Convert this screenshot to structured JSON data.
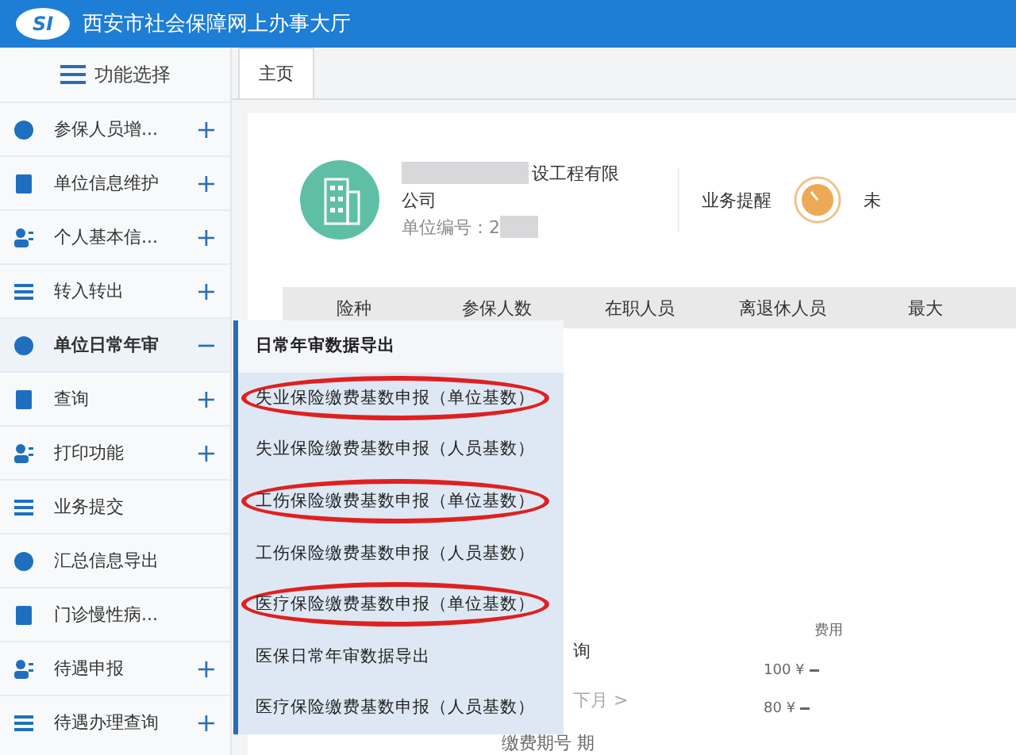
{
  "header": {
    "logo": "SI",
    "title": "西安市社会保障网上办事大厅"
  },
  "sidebar": {
    "title": "功能选择",
    "items": [
      {
        "label": "参保人员增...",
        "toggle": "+",
        "expanded": false
      },
      {
        "label": "单位信息维护",
        "toggle": "+",
        "expanded": false
      },
      {
        "label": "个人基本信...",
        "toggle": "+",
        "expanded": false
      },
      {
        "label": "转入转出",
        "toggle": "+",
        "expanded": false
      },
      {
        "label": "单位日常年审",
        "toggle": "−",
        "expanded": true
      },
      {
        "label": "查询",
        "toggle": "+",
        "expanded": false
      },
      {
        "label": "打印功能",
        "toggle": "+",
        "expanded": false
      },
      {
        "label": "业务提交",
        "expanded": false
      },
      {
        "label": "汇总信息导出",
        "expanded": false
      },
      {
        "label": "门诊慢性病...",
        "expanded": false
      },
      {
        "label": "待遇申报",
        "toggle": "+",
        "expanded": false
      },
      {
        "label": "待遇办理查询",
        "toggle": "+",
        "expanded": false
      }
    ]
  },
  "submenu": {
    "items": [
      {
        "label": "日常年审数据导出",
        "selected": true,
        "circled": false
      },
      {
        "label": "失业保险缴费基数申报（单位基数）",
        "selected": false,
        "circled": true
      },
      {
        "label": "失业保险缴费基数申报（人员基数）",
        "selected": false,
        "circled": false
      },
      {
        "label": "工伤保险缴费基数申报（单位基数）",
        "selected": false,
        "circled": true
      },
      {
        "label": "工伤保险缴费基数申报（人员基数）",
        "selected": false,
        "circled": false
      },
      {
        "label": "医疗保险缴费基数申报（单位基数）",
        "selected": false,
        "circled": true
      },
      {
        "label": "医保日常年审数据导出",
        "selected": false,
        "circled": false
      },
      {
        "label": "医疗保险缴费基数申报（人员基数）",
        "selected": false,
        "circled": false
      }
    ]
  },
  "tabs": [
    {
      "label": "主页",
      "selected": true
    }
  ],
  "company": {
    "name_line1": "设工程有限",
    "name_line2": "公司",
    "unit_number": "单位编号：2"
  },
  "reminder": {
    "label": "业务提醒",
    "status": "未"
  },
  "table": {
    "columns": [
      "险种",
      "参保人数",
      "在职人员",
      "离退休人员",
      "最大"
    ]
  },
  "calendar": {
    "title": "询",
    "next": "下月 >",
    "period": "缴费期号 期"
  },
  "chart": {
    "title": "费用",
    "yticks": [
      "100 ¥",
      "80 ¥"
    ]
  }
}
